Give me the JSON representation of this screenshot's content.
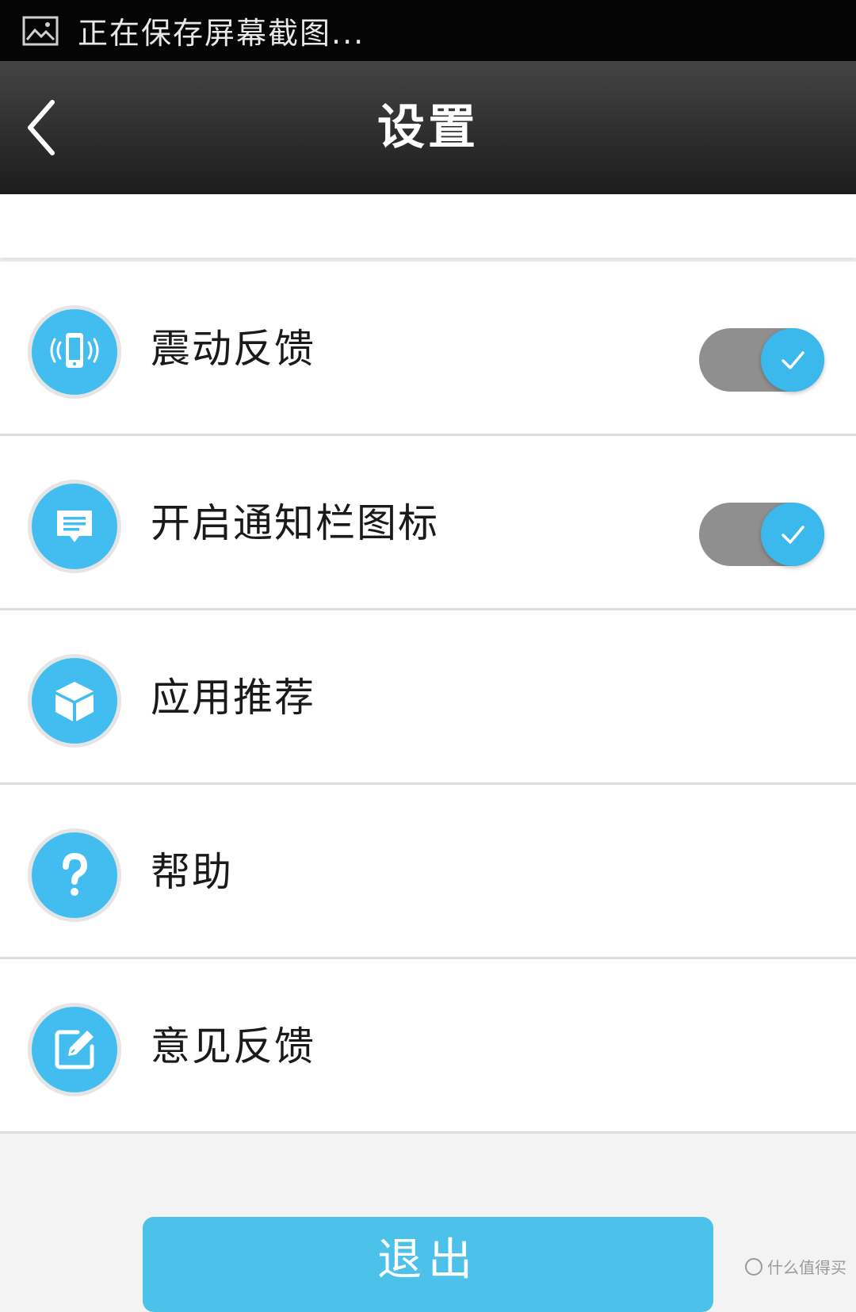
{
  "status_bar": {
    "text": "正在保存屏幕截图...",
    "icon": "image-icon"
  },
  "header": {
    "back_icon": "chevron-left-icon",
    "title": "设置"
  },
  "settings": {
    "items": [
      {
        "label": "震动反馈",
        "icon": "vibrate-phone-icon",
        "toggle": true,
        "toggle_on": true
      },
      {
        "label": "开启通知栏图标",
        "icon": "message-icon",
        "toggle": true,
        "toggle_on": true
      },
      {
        "label": "应用推荐",
        "icon": "cube-icon",
        "toggle": false
      },
      {
        "label": "帮助",
        "icon": "help-icon",
        "toggle": false
      },
      {
        "label": "意见反馈",
        "icon": "edit-icon",
        "toggle": false
      }
    ]
  },
  "logout": {
    "label": "退出"
  },
  "watermark": {
    "text": "什么值得买"
  },
  "colors": {
    "accent": "#43bdf0",
    "toggle_track": "#8f8f8f",
    "header_bg": "#2a2a2a",
    "status_bar_bg": "#050505",
    "logout_bg": "#4cc1ea"
  }
}
